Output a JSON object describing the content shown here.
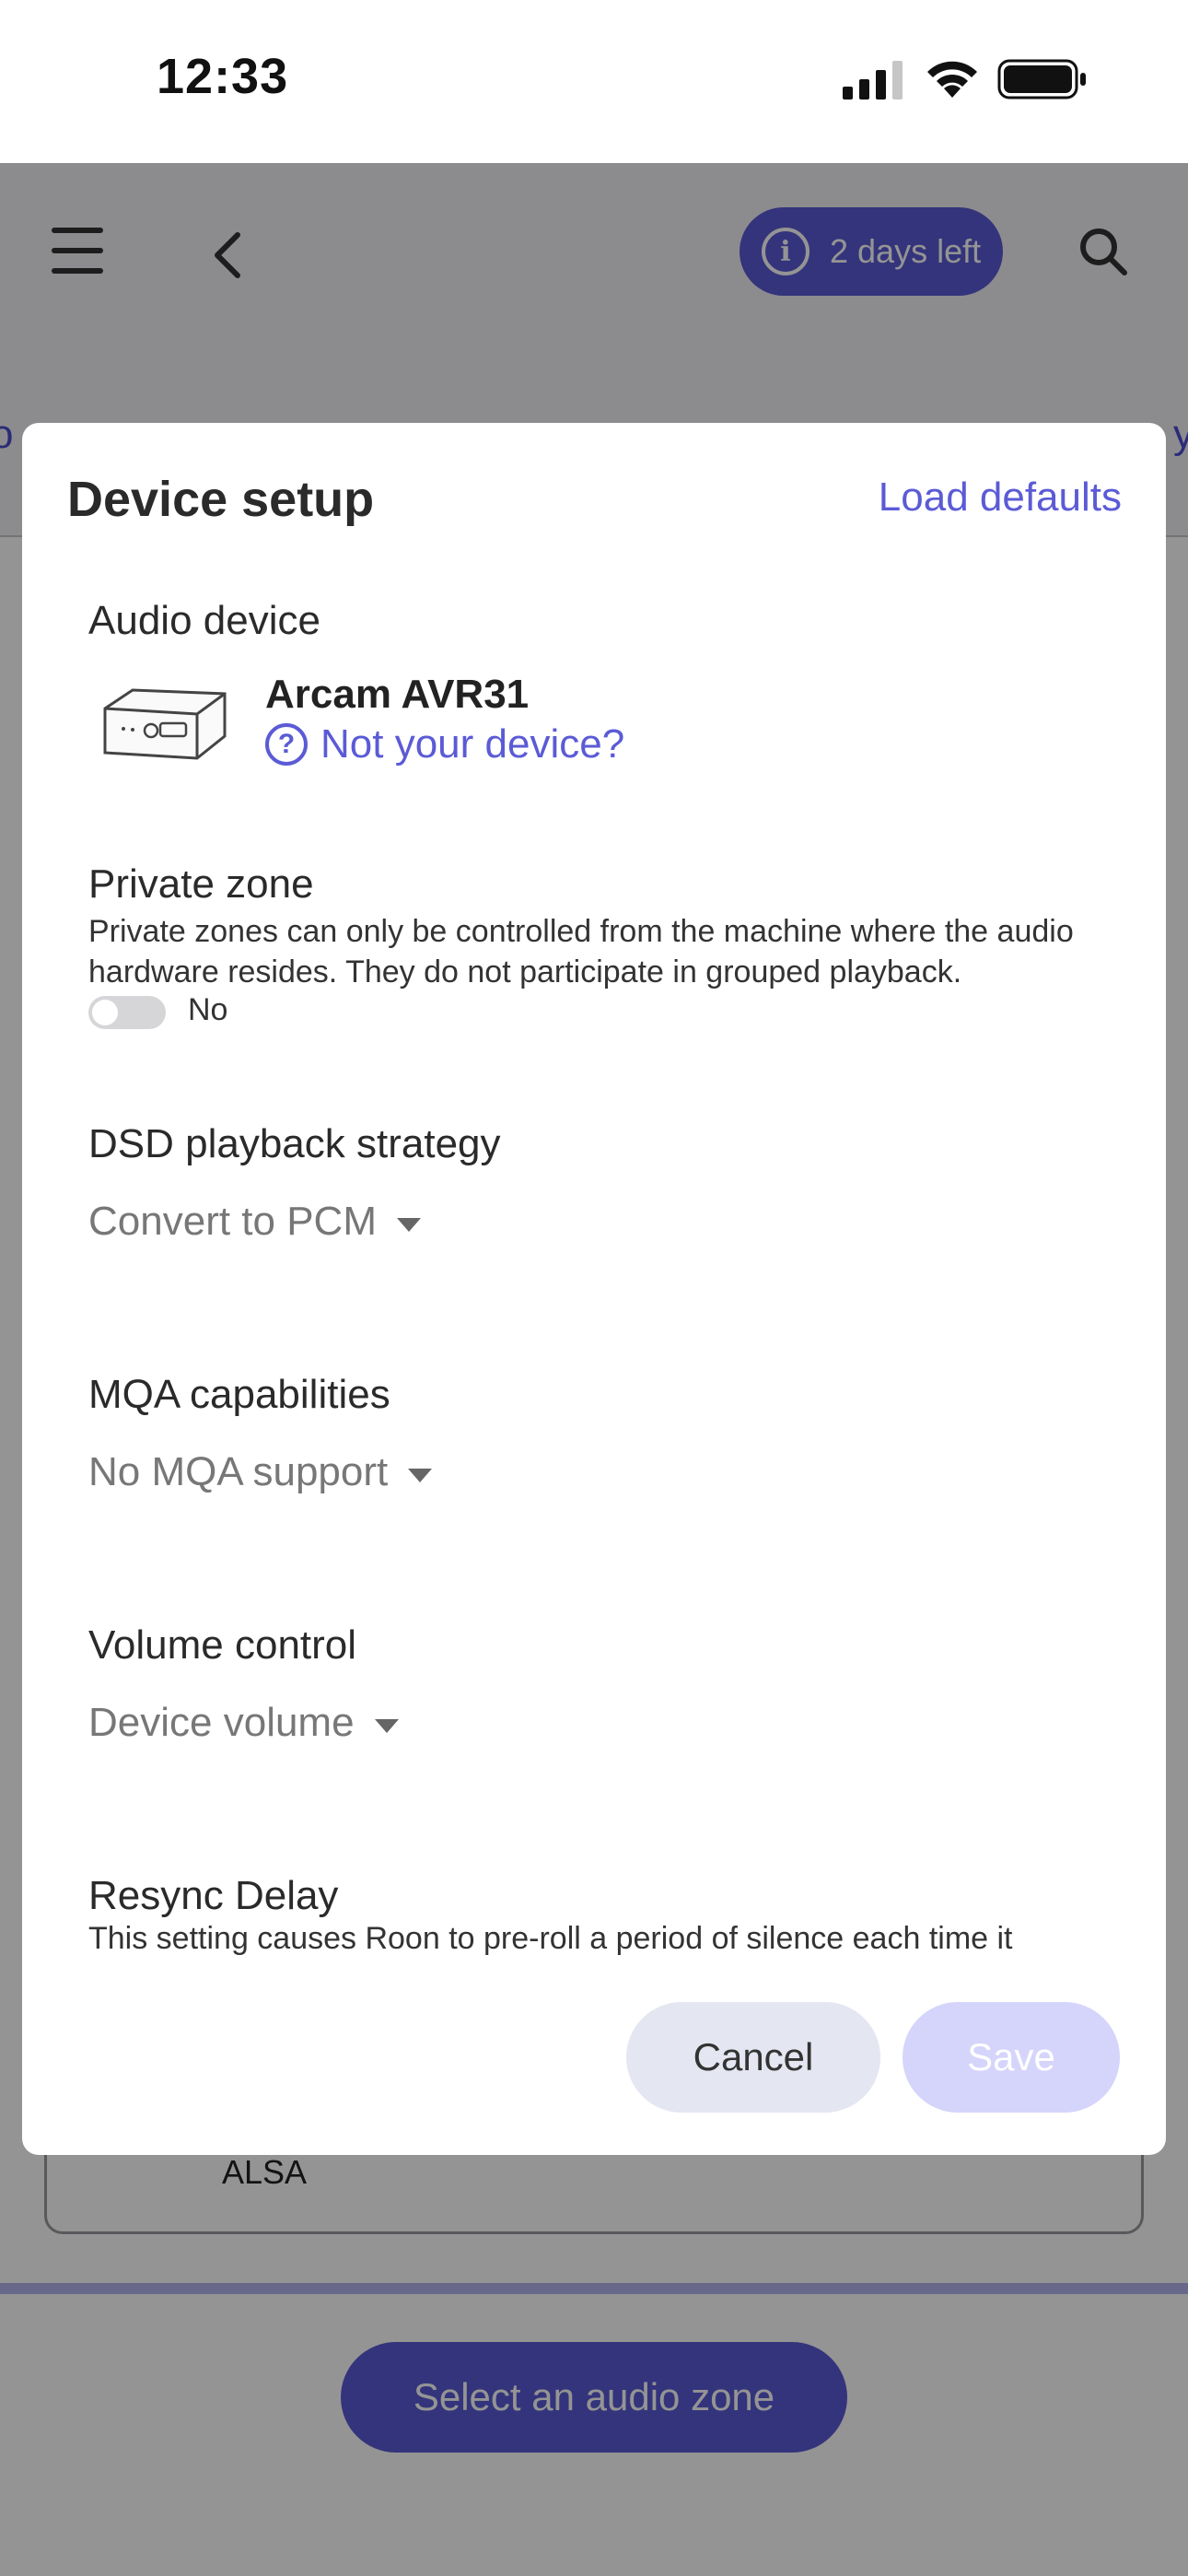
{
  "status_bar": {
    "time": "12:33"
  },
  "header": {
    "trial_badge": "2 days left",
    "tab_partial_left": "o",
    "tab_partial_right": "y"
  },
  "background": {
    "device_card_label": "ALSA",
    "zone_button": "Select an audio zone"
  },
  "modal": {
    "title": "Device setup",
    "load_defaults": "Load defaults",
    "audio_device": {
      "label": "Audio device",
      "name": "Arcam AVR31",
      "not_your_device": "Not your device?"
    },
    "private_zone": {
      "label": "Private zone",
      "description": "Private zones can only be controlled from the machine where the audio hardware resides. They do not participate in grouped playback.",
      "toggle_value": "No"
    },
    "dsd": {
      "label": "DSD playback strategy",
      "value": "Convert to PCM"
    },
    "mqa": {
      "label": "MQA capabilities",
      "value": "No MQA support"
    },
    "volume": {
      "label": "Volume control",
      "value": "Device volume"
    },
    "resync": {
      "label": "Resync Delay",
      "description": "This setting causes Roon to pre-roll a period of silence each time it"
    },
    "cancel": "Cancel",
    "save": "Save"
  },
  "colors": {
    "accent": "#5b5bd6",
    "save_disabled": "#d5d4fb",
    "cancel_bg": "#e4e6f1"
  }
}
